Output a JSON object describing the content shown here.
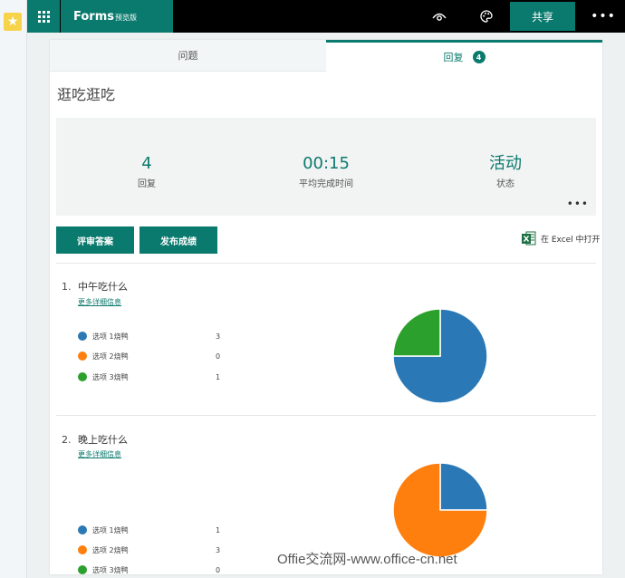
{
  "app": {
    "name": "Forms",
    "edition": "预览版",
    "share_label": "共享",
    "more_label": "•••"
  },
  "tabs": [
    {
      "label": "问题"
    },
    {
      "label": "回复",
      "badge": "4"
    }
  ],
  "form": {
    "title": "逛吃逛吃"
  },
  "summary": {
    "responses_value": "4",
    "responses_label": "回复",
    "avg_time_value": "00:15",
    "avg_time_label": "平均完成时间",
    "status_value": "活动",
    "status_label": "状态",
    "more_label": "•••"
  },
  "actions": {
    "review_label": "评审答案",
    "publish_label": "发布成绩",
    "excel_label": "在 Excel 中打开"
  },
  "colors": {
    "accent": "#0b7a6e",
    "option1": "#2a78b5",
    "option2": "#ff7f0e",
    "option3": "#2ca02c"
  },
  "questions": [
    {
      "number": "1.",
      "title": "中午吃什么",
      "details_label": "更多详细信息",
      "options": [
        {
          "label": "选项 1烧鸭",
          "count": "3"
        },
        {
          "label": "选项 2烧鸭",
          "count": "0"
        },
        {
          "label": "选项 3烧鸭",
          "count": "1"
        }
      ]
    },
    {
      "number": "2.",
      "title": "晚上吃什么",
      "details_label": "更多详细信息",
      "options": [
        {
          "label": "选项 1烧鸭",
          "count": "1"
        },
        {
          "label": "选项 2烧鸭",
          "count": "3"
        },
        {
          "label": "选项 3烧鸭",
          "count": "0"
        }
      ]
    }
  ],
  "chart_data": [
    {
      "type": "pie",
      "categories": [
        "选项 1烧鸭",
        "选项 2烧鸭",
        "选项 3烧鸭"
      ],
      "values": [
        3,
        0,
        1
      ]
    },
    {
      "type": "pie",
      "categories": [
        "选项 1烧鸭",
        "选项 2烧鸭",
        "选项 3烧鸭"
      ],
      "values": [
        1,
        3,
        0
      ]
    }
  ],
  "watermark": "Offie交流网-www.office-cn.net"
}
